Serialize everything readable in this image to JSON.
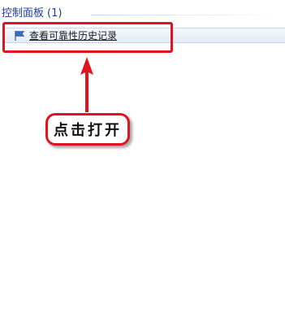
{
  "control_panel_group": {
    "title": "控制面板",
    "count": "(1)"
  },
  "result": {
    "icon": "flag-icon",
    "label": "查看可靠性历史记录"
  },
  "annotation": {
    "callout_text": "点击打开",
    "highlight_color": "#e0141c",
    "arrow": "up-arrow-icon"
  }
}
